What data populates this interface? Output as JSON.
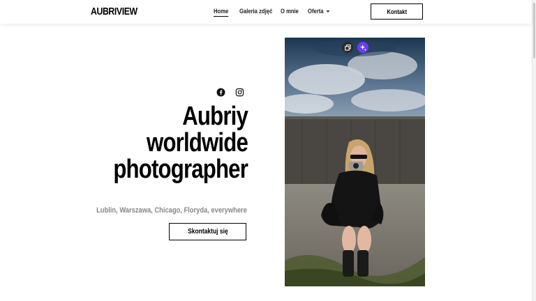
{
  "header": {
    "logo": "AUBRIVIEW",
    "nav": [
      {
        "label": "Home",
        "active": true
      },
      {
        "label": "Galeria zdjęć",
        "active": false
      },
      {
        "label": "O mnie",
        "active": false
      },
      {
        "label": "Oferta",
        "active": false,
        "dropdown": true
      }
    ],
    "contact_label": "Kontakt"
  },
  "hero": {
    "social": [
      "facebook-icon",
      "instagram-icon"
    ],
    "title_lines": [
      "Aubriy",
      "worldwide",
      "photographer"
    ],
    "subtitle": "Lublin, Warszawa, Chicago, Floryda, everywhere",
    "cta_label": "Skontaktuj się"
  },
  "photo": {
    "tools": [
      "duplicate-icon",
      "ai-sparkle-icon"
    ]
  },
  "colors": {
    "accent": "#6b3cf5",
    "subtitle": "#888888"
  }
}
